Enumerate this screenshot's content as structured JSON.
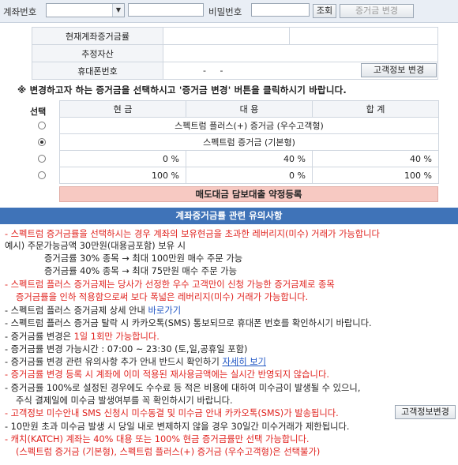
{
  "top": {
    "account_label": "계좌번호",
    "password_label": "비밀번호",
    "query_button": "조회",
    "change_button": "증거금 변경"
  },
  "info": {
    "rows": [
      {
        "label": "현재계좌증거금률",
        "value": ""
      },
      {
        "label": "추정자산",
        "value": ""
      },
      {
        "label": "휴대폰번호",
        "value": "-     -"
      }
    ],
    "customer_button": "고객정보 변경"
  },
  "notice": "※ 변경하고자 하는 증거금을 선택하시고 '증거금 변경' 버튼을 클릭하시기 바랍니다.",
  "grid": {
    "select_header": "선택",
    "headers": [
      "현 금",
      "대 용",
      "합 계"
    ],
    "rows": [
      {
        "type": "merged",
        "text": "스펙트럼 플러스(+) 증거금 (우수고객형)",
        "selected": false
      },
      {
        "type": "merged",
        "text": "스펙트럼 증거금 (기본형)",
        "selected": true
      },
      {
        "type": "cells",
        "cells": [
          "0 %",
          "40 %",
          "40 %"
        ],
        "selected": false
      },
      {
        "type": "cells",
        "cells": [
          "100 %",
          "0 %",
          "100 %"
        ],
        "selected": false
      }
    ],
    "pink_button": "매도대금 담보대출 약정등록"
  },
  "notes_title": "계좌증거금률 관련 유의사항",
  "notes": {
    "n1": "- 스펙트럼 증거금률을 선택하시는 경우 계좌의 보유현금을 초과한 레버리지(미수) 거래가 가능합니다",
    "n2": "예시) 주문가능금액 30만원(대용금포함) 보유 시",
    "n3": "증거금률 30% 종목 → 최대 100만원 매수 주문 가능",
    "n4": "증거금률 40% 종목 → 최대 75만원 매수 주문 가능",
    "n5": "- 스펙트럼 플러스 증거금제는 당사가 선정한 우수 고객만이 신청 가능한 증거금제로 종목",
    "n6": "증거금률을 인하 적용함으로써 보다 폭넓은 레버리지(미수) 거래가 가능합니다.",
    "n7a": "- 스펙트럼 플러스 증거금제 상세 안내 ",
    "n7b": "바로가기",
    "n8": "- 스펙트럼 플러스 증거금 탈락 시 카카오톡(SMS) 통보되므로 휴대폰 번호를 확인하시기 바랍니다.",
    "n9a": "- 증거금률 변경은 ",
    "n9b": "1일 1회만 가능합니다.",
    "n10": "- 증거금률 변경 가능시간 : 07:00 ~ 23:30 (토,일,공휴일 포함)",
    "n11a": "- 증거금률 변경 관련 유의사항 추가 안내 반드시 확인하기 ",
    "n11b": "자세히 보기",
    "n12": "- 증거금률 변경 등록 시 계좌에 이미 적용된 재사용금액에는 실시간 반영되지 않습니다.",
    "n13": "- 증거금률 100%로 설정된 경우에도 수수료 등 적은 비용에 대하여 미수금이 발생될 수 있으니,",
    "n14": "주식 결제일에 미수금 발생여부를 꼭 확인하시기 바랍니다.",
    "n15": "- 고객정보 미수안내 SMS 신청시 미수동결 및 미수금 안내 카카오톡(SMS)가 발송됩니다.",
    "n15_button": "고객정보변경",
    "n16": "- 10만원 초과 미수금 발생 시 당일 내로 변제하지 않을 경우 30일간 미수거래가 제한됩니다.",
    "n17": "- 캐치(KATCH) 계좌는 40% 대용 또는 100% 현금 증거금률만 선택 가능합니다.",
    "n18": "(스펙트럼 증거금 (기본형), 스펙트럼 플러스(+) 증거금 (우수고객형)은 선택불가)"
  }
}
